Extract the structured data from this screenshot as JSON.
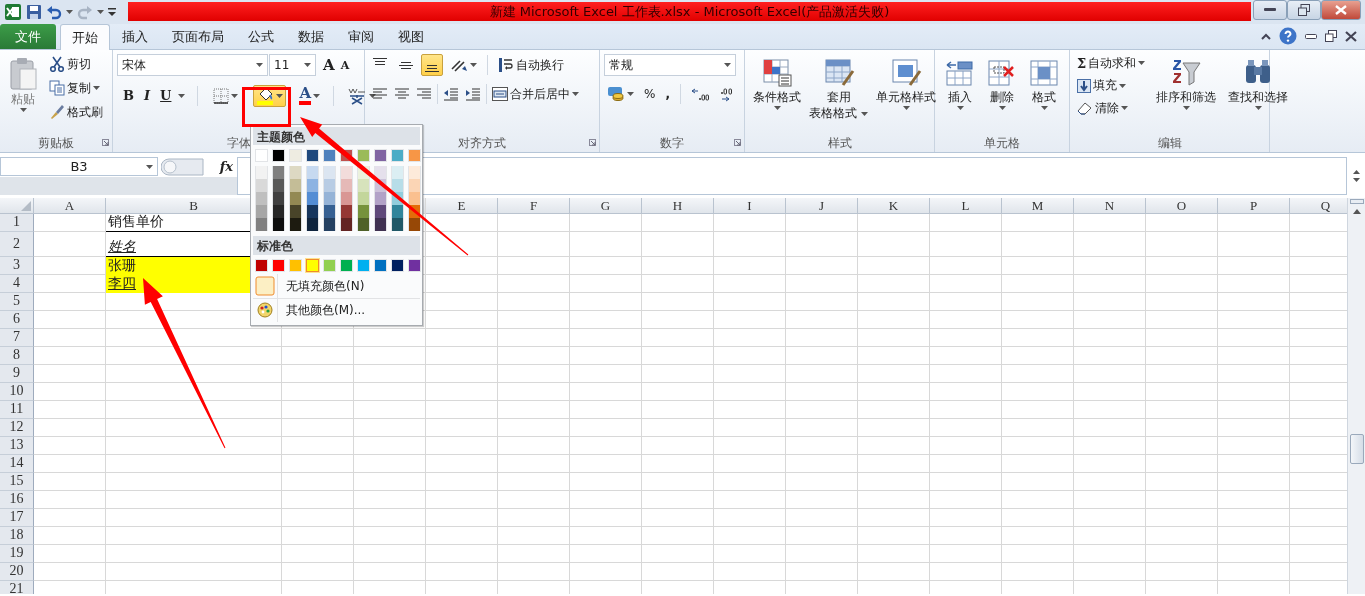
{
  "title_bar": {
    "title": "新建 Microsoft Excel 工作表.xlsx - Microsoft Excel(产品激活失败)"
  },
  "tabs": [
    {
      "label": "文件",
      "kind": "file",
      "selected": false
    },
    {
      "label": "开始",
      "kind": "tab",
      "selected": true
    },
    {
      "label": "插入",
      "kind": "tab",
      "selected": false
    },
    {
      "label": "页面布局",
      "kind": "tab",
      "selected": false
    },
    {
      "label": "公式",
      "kind": "tab",
      "selected": false
    },
    {
      "label": "数据",
      "kind": "tab",
      "selected": false
    },
    {
      "label": "审阅",
      "kind": "tab",
      "selected": false
    },
    {
      "label": "视图",
      "kind": "tab",
      "selected": false
    }
  ],
  "ribbon": {
    "clipboard": {
      "title": "剪贴板",
      "paste": "粘贴",
      "cut": "剪切",
      "copy": "复制",
      "format_painter": "格式刷"
    },
    "font": {
      "title": "字体",
      "font_name": "宋体",
      "font_size": "11",
      "grow": "A",
      "shrink": "A",
      "bold": "B",
      "italic": "I",
      "underline": "U",
      "fill": {
        "color": "#ffff00",
        "open": true
      },
      "font_color": {
        "glyph": "A",
        "color": "#ff0000"
      }
    },
    "alignment": {
      "title": "对齐方式",
      "vertical": [
        {
          "kind": "top",
          "on": false
        },
        {
          "kind": "middle",
          "on": false
        },
        {
          "kind": "bottom",
          "on": true
        }
      ],
      "wrap_text": "自动换行",
      "merge_center": "合并后居中"
    },
    "number": {
      "title": "数字",
      "format": "常规",
      "percent": "%",
      "comma": ","
    },
    "styles": {
      "title": "样式",
      "buttons": [
        {
          "kind": "conditional",
          "lines": [
            "条件格式"
          ]
        },
        {
          "kind": "table",
          "lines": [
            "套用",
            "表格格式"
          ]
        },
        {
          "kind": "cellstyle",
          "lines": [
            "单元格样式"
          ]
        }
      ]
    },
    "cells": {
      "title": "单元格",
      "buttons": [
        {
          "kind": "insert",
          "lines": [
            "插入"
          ]
        },
        {
          "kind": "delete",
          "lines": [
            "删除"
          ]
        },
        {
          "kind": "format",
          "lines": [
            "格式"
          ]
        }
      ]
    },
    "editing": {
      "title": "编辑",
      "small": [
        {
          "kind": "sum",
          "glyph": "Σ",
          "label": "自动求和"
        },
        {
          "kind": "fill",
          "label": "填充"
        },
        {
          "kind": "clear",
          "label": "清除"
        }
      ],
      "big": [
        {
          "kind": "sort",
          "lines": [
            "排序和筛选"
          ]
        },
        {
          "kind": "find",
          "lines": [
            "查找和选择"
          ]
        }
      ]
    }
  },
  "formula_bar": {
    "name_box": "B3",
    "fx": "fx"
  },
  "sheet": {
    "columns_left": [
      "A",
      "B"
    ],
    "columns_right": [
      "E",
      "F",
      "G",
      "H",
      "I",
      "J",
      "K",
      "L",
      "M",
      "N",
      "O",
      "P",
      "Q"
    ],
    "rows": [
      {
        "number": "1",
        "tall": false,
        "cell_b": {
          "text": "销售单价",
          "italic": false,
          "underline": false,
          "highlighted": false,
          "border_bottom": true
        }
      },
      {
        "number": "2",
        "tall": true,
        "cell_b": {
          "text": "姓名",
          "italic": true,
          "underline": true,
          "highlighted": false,
          "border_bottom": true
        }
      },
      {
        "number": "3",
        "tall": false,
        "cell_b": {
          "text": "张珊",
          "italic": false,
          "underline": false,
          "highlighted": true,
          "border_bottom": false
        }
      },
      {
        "number": "4",
        "tall": false,
        "cell_b": {
          "text": "李四",
          "italic": false,
          "underline": true,
          "highlighted": true,
          "border_bottom": false
        }
      },
      {
        "number": "5",
        "tall": false
      },
      {
        "number": "6",
        "tall": false
      },
      {
        "number": "7",
        "tall": false
      },
      {
        "number": "8",
        "tall": false
      },
      {
        "number": "9",
        "tall": false
      },
      {
        "number": "10",
        "tall": false
      },
      {
        "number": "11",
        "tall": false
      },
      {
        "number": "12",
        "tall": false
      },
      {
        "number": "13",
        "tall": false
      },
      {
        "number": "14",
        "tall": false
      },
      {
        "number": "15",
        "tall": false
      },
      {
        "number": "16",
        "tall": false
      },
      {
        "number": "17",
        "tall": false
      },
      {
        "number": "18",
        "tall": false
      },
      {
        "number": "19",
        "tall": false
      },
      {
        "number": "20",
        "tall": false
      },
      {
        "number": "21",
        "tall": false
      }
    ]
  },
  "fill_menu": {
    "theme_title": "主题颜色",
    "standard_title": "标准色",
    "no_fill": "无填充颜色(N)",
    "more": "其他颜色(M)...",
    "theme": [
      {
        "color": "#ffffff",
        "selected": false,
        "shades": [
          {
            "color": "#f2f2f2",
            "selected": false
          },
          {
            "color": "#d9d9d9",
            "selected": false
          },
          {
            "color": "#bfbfbf",
            "selected": false
          },
          {
            "color": "#a6a6a6",
            "selected": false
          },
          {
            "color": "#808080",
            "selected": false
          }
        ]
      },
      {
        "color": "#000000",
        "selected": false,
        "shades": [
          {
            "color": "#7f7f7f",
            "selected": false
          },
          {
            "color": "#595959",
            "selected": false
          },
          {
            "color": "#404040",
            "selected": false
          },
          {
            "color": "#262626",
            "selected": false
          },
          {
            "color": "#0d0d0d",
            "selected": false
          }
        ]
      },
      {
        "color": "#eeece1",
        "selected": false,
        "shades": [
          {
            "color": "#ddd9c3",
            "selected": false
          },
          {
            "color": "#c4bd97",
            "selected": false
          },
          {
            "color": "#938953",
            "selected": false
          },
          {
            "color": "#494429",
            "selected": false
          },
          {
            "color": "#1d1b10",
            "selected": false
          }
        ]
      },
      {
        "color": "#1f497d",
        "selected": false,
        "shades": [
          {
            "color": "#c6d9f0",
            "selected": false
          },
          {
            "color": "#8db3e2",
            "selected": false
          },
          {
            "color": "#548dd4",
            "selected": false
          },
          {
            "color": "#17365d",
            "selected": false
          },
          {
            "color": "#0f243e",
            "selected": false
          }
        ]
      },
      {
        "color": "#4f81bd",
        "selected": false,
        "shades": [
          {
            "color": "#dbe5f1",
            "selected": false
          },
          {
            "color": "#b8cce4",
            "selected": false
          },
          {
            "color": "#95b3d7",
            "selected": false
          },
          {
            "color": "#366092",
            "selected": false
          },
          {
            "color": "#244061",
            "selected": false
          }
        ]
      },
      {
        "color": "#c0504d",
        "selected": false,
        "shades": [
          {
            "color": "#f2dcdb",
            "selected": false
          },
          {
            "color": "#e5b9b7",
            "selected": false
          },
          {
            "color": "#d99694",
            "selected": false
          },
          {
            "color": "#953734",
            "selected": false
          },
          {
            "color": "#632423",
            "selected": false
          }
        ]
      },
      {
        "color": "#9bbb59",
        "selected": false,
        "shades": [
          {
            "color": "#ebf1dd",
            "selected": false
          },
          {
            "color": "#d7e3bc",
            "selected": false
          },
          {
            "color": "#c3d69b",
            "selected": false
          },
          {
            "color": "#76923c",
            "selected": false
          },
          {
            "color": "#4f6128",
            "selected": false
          }
        ]
      },
      {
        "color": "#8064a2",
        "selected": false,
        "shades": [
          {
            "color": "#e5e0ec",
            "selected": false
          },
          {
            "color": "#ccc1d9",
            "selected": false
          },
          {
            "color": "#b2a2c7",
            "selected": false
          },
          {
            "color": "#5f497a",
            "selected": false
          },
          {
            "color": "#3f3151",
            "selected": false
          }
        ]
      },
      {
        "color": "#4bacc6",
        "selected": false,
        "shades": [
          {
            "color": "#dbeef3",
            "selected": false
          },
          {
            "color": "#b7dde8",
            "selected": false
          },
          {
            "color": "#92cddc",
            "selected": false
          },
          {
            "color": "#31859b",
            "selected": false
          },
          {
            "color": "#205867",
            "selected": false
          }
        ]
      },
      {
        "color": "#f79646",
        "selected": false,
        "shades": [
          {
            "color": "#fdeada",
            "selected": false
          },
          {
            "color": "#fbd5b5",
            "selected": false
          },
          {
            "color": "#fac08f",
            "selected": false
          },
          {
            "color": "#e36c09",
            "selected": false
          },
          {
            "color": "#974806",
            "selected": false
          }
        ]
      }
    ],
    "standard": [
      {
        "color": "#c00000",
        "selected": false
      },
      {
        "color": "#ff0000",
        "selected": false
      },
      {
        "color": "#ffc000",
        "selected": false
      },
      {
        "color": "#ffff00",
        "selected": true
      },
      {
        "color": "#92d050",
        "selected": false
      },
      {
        "color": "#00b050",
        "selected": false
      },
      {
        "color": "#00b0f0",
        "selected": false
      },
      {
        "color": "#0070c0",
        "selected": false
      },
      {
        "color": "#002060",
        "selected": false
      },
      {
        "color": "#7030a0",
        "selected": false
      }
    ]
  }
}
